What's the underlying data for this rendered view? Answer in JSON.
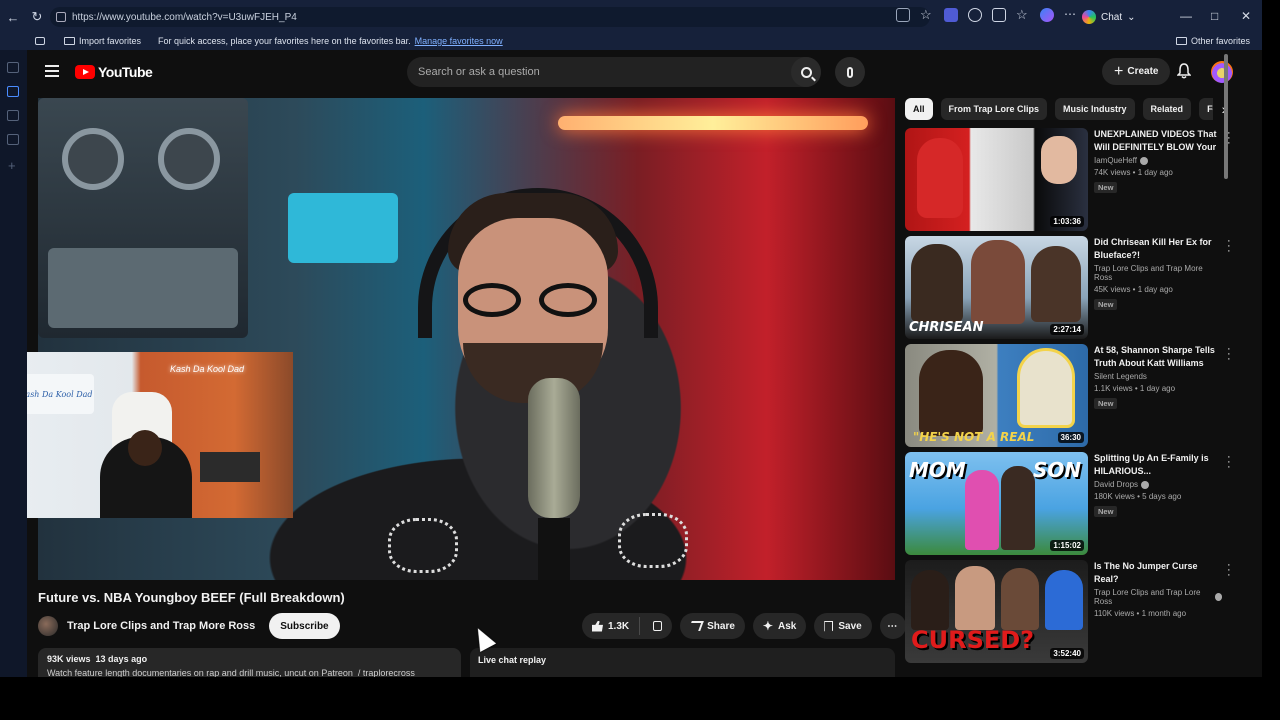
{
  "browser": {
    "url": "https://www.youtube.com/watch?v=U3uwFJEH_P4",
    "chat_label": "Chat",
    "favorites": {
      "import_label": "Import favorites",
      "message": "For quick access, place your favorites here on the favorites bar.",
      "manage_link": "Manage favorites now",
      "other_label": "Other favorites"
    }
  },
  "yt": {
    "logo_text": "YouTube",
    "search_placeholder": "Search or ask a question",
    "create_label": "Create"
  },
  "pip": {
    "sign_text": "Kash Da Kool Dad",
    "neon_text": "Kash Da Kool Dad"
  },
  "video": {
    "title": "Future vs. NBA Youngboy BEEF (Full Breakdown)",
    "channel": "Trap Lore Clips and Trap More Ross",
    "subscribe_label": "Subscribe",
    "likes": "1.3K",
    "share_label": "Share",
    "ask_label": "Ask",
    "save_label": "Save",
    "views": "93K views",
    "age": "13 days ago",
    "description_preview": "Watch feature length documentaries on rap and drill music, uncut on Patreon",
    "description_handle": "/ traplorecross",
    "chat_replay_label": "Live chat replay"
  },
  "chips": [
    "All",
    "From Trap Lore Clips",
    "Music Industry",
    "Related",
    "For You"
  ],
  "recommendations": [
    {
      "title": "UNEXPLAINED VIDEOS That Will DEFINITELY BLOW Your ...",
      "channel": "IamQueHeff",
      "verified": true,
      "stats": "74K views • 1 day ago",
      "badge": "New",
      "duration": "1:03:36"
    },
    {
      "title": "Did Chrisean Kill Her Ex for Blueface?!",
      "channel": "Trap Lore Clips and Trap More Ross",
      "verified": false,
      "stats": "45K views • 1 day ago",
      "badge": "New",
      "duration": "2:27:14",
      "overlay": "CHRISEAN"
    },
    {
      "title": "At 58, Shannon Sharpe Tells Truth About Katt Williams",
      "channel": "Silent Legends",
      "verified": false,
      "stats": "1.1K views • 1 day ago",
      "badge": "New",
      "duration": "36:30",
      "overlay": "\"HE'S NOT A REAL"
    },
    {
      "title": "Splitting Up An E-Family is HILARIOUS...",
      "channel": "David Drops",
      "verified": true,
      "stats": "180K views • 5 days ago",
      "badge": "New",
      "duration": "1:15:02",
      "overlay_left": "MOM",
      "overlay_right": "SON"
    },
    {
      "title": "Is The No Jumper Curse Real?",
      "channel": "Trap Lore Clips and Trap Lore Ross",
      "verified": true,
      "stats": "110K views • 1 month ago",
      "badge": "",
      "duration": "3:52:40",
      "overlay": "CURSED?"
    }
  ],
  "colors": {
    "brand_red": "#ff0000",
    "bg": "#0f0f0f",
    "chip": "#272727"
  }
}
